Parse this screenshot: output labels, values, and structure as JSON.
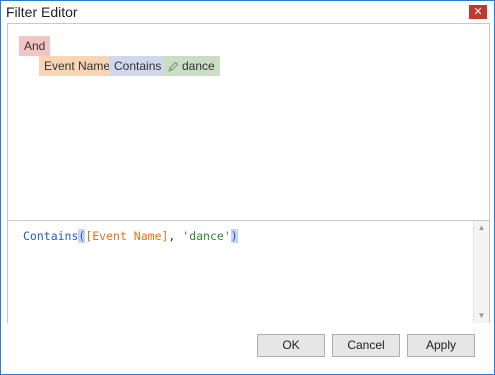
{
  "window": {
    "title": "Filter Editor",
    "close_icon": "close-icon"
  },
  "tree": {
    "group_operator": "And",
    "condition": {
      "field": "Event Name",
      "operator": "Contains",
      "value": "dance",
      "value_icon": "pencil-icon"
    }
  },
  "expression": {
    "function": "Contains",
    "open_paren": "(",
    "field": "[Event Name]",
    "separator": ", ",
    "value": "'dance'",
    "close_paren": ")"
  },
  "buttons": {
    "ok": "OK",
    "cancel": "Cancel",
    "apply": "Apply"
  },
  "colors": {
    "group_chip": "#f3c4c4",
    "field_chip": "#f8d5b5",
    "operator_chip": "#cfd8ec",
    "value_chip": "#c9dec4",
    "window_border": "#2b7bd0",
    "close_button": "#c0392b"
  }
}
